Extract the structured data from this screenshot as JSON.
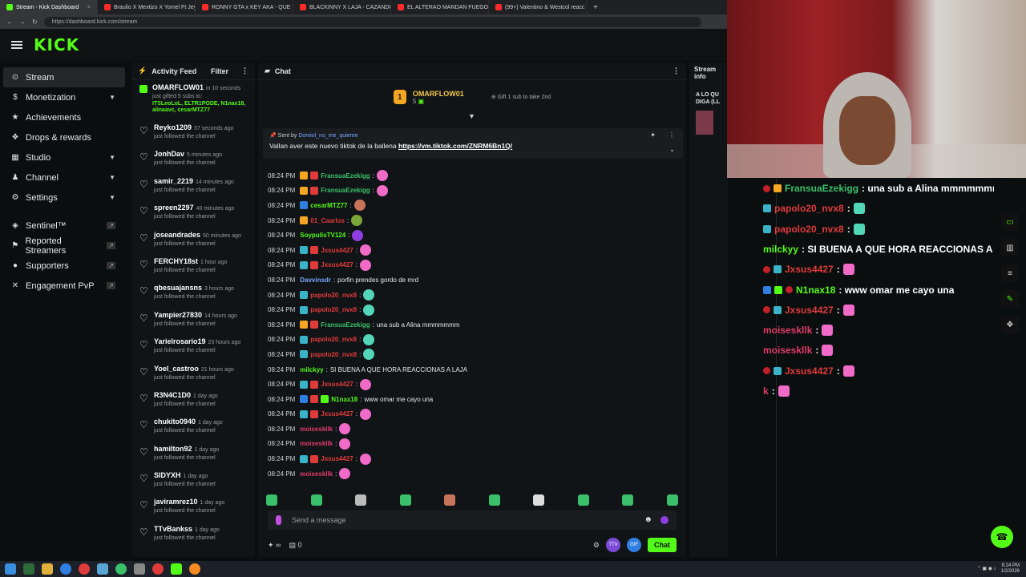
{
  "browser": {
    "tabs": [
      {
        "title": "Stream - Kick Dashboard",
        "color": "#53fc18",
        "active": true
      },
      {
        "title": "Braulio X Mextizo X Yomel Ft Jey",
        "color": "#ff2a2a"
      },
      {
        "title": "RONNY GTA x KEY AKA - QUE TE",
        "color": "#ff2a2a"
      },
      {
        "title": "BLACKINNY X LAJA - CAZANDO",
        "color": "#ff2a2a"
      },
      {
        "title": "EL ALTERAO MANDAN FUEGO",
        "color": "#ff2a2a"
      },
      {
        "title": "(99+) Valentino & Westcol reacc",
        "color": "#ff2a2a"
      }
    ],
    "url": "https://dashboard.kick.com/stream"
  },
  "header": {
    "logo": "KICK"
  },
  "sidebar": {
    "items": [
      {
        "label": "Stream",
        "icon": "stream-icon",
        "glyph": "⊙",
        "active": true
      },
      {
        "label": "Monetization",
        "icon": "dollar-icon",
        "glyph": "$",
        "chevron": true
      },
      {
        "label": "Achievements",
        "icon": "trophy-icon",
        "glyph": "★"
      },
      {
        "label": "Drops & rewards",
        "icon": "gift-icon",
        "glyph": "❖"
      },
      {
        "label": "Studio",
        "icon": "studio-icon",
        "glyph": "▦",
        "chevron": true
      },
      {
        "label": "Channel",
        "icon": "channel-icon",
        "glyph": "♟",
        "chevron": true
      },
      {
        "label": "Settings",
        "icon": "gear-icon",
        "glyph": "⚙",
        "chevron": true
      }
    ],
    "tools": [
      {
        "label": "Sentinel™",
        "icon": "shield-icon",
        "glyph": "◈"
      },
      {
        "label": "Reported Streamers",
        "icon": "flag-icon",
        "glyph": "⚑"
      },
      {
        "label": "Supporters",
        "icon": "users-icon",
        "glyph": "●"
      },
      {
        "label": "Engagement PvP",
        "icon": "swords-icon",
        "glyph": "✕"
      }
    ]
  },
  "activity": {
    "title": "Activity Feed",
    "filter_label": "Filter",
    "gift": {
      "name": "OMARFLOW01",
      "time": "in 10 seconds",
      "text": "just gifted 5 subs to:",
      "recipients": "ITSLeoLoL, ELTR1PODE, N1nax18, alinaavc, cesarMTZ77"
    },
    "follows": [
      {
        "name": "Reyko1209",
        "time": "37 seconds ago"
      },
      {
        "name": "JonhDav",
        "time": "5 minutes ago"
      },
      {
        "name": "samir_2219",
        "time": "14 minutes ago"
      },
      {
        "name": "spreen2297",
        "time": "40 minutes ago"
      },
      {
        "name": "joseandrades",
        "time": "50 minutes ago"
      },
      {
        "name": "FERCHY18st",
        "time": "1 hour ago"
      },
      {
        "name": "qbesuajansns",
        "time": "3 hours ago"
      },
      {
        "name": "Yampier27830",
        "time": "14 hours ago"
      },
      {
        "name": "Yarielrosario19",
        "time": "20 hours ago"
      },
      {
        "name": "Yoel_castroo",
        "time": "21 hours ago"
      },
      {
        "name": "R3N4C1D0",
        "time": "1 day ago"
      },
      {
        "name": "chukito0940",
        "time": "1 day ago"
      },
      {
        "name": "hamilton92",
        "time": "1 day ago"
      },
      {
        "name": "SIDYXH",
        "time": "1 day ago"
      },
      {
        "name": "javiramrez10",
        "time": "1 day ago"
      },
      {
        "name": "TTvBankss",
        "time": "1 day ago"
      }
    ],
    "follow_text": "just followed the channel"
  },
  "chat": {
    "title": "Chat",
    "top_gifter": {
      "rank": "1",
      "name": "OMARFLOW01",
      "count": "5",
      "hint": "Gift 1 sub to take 2nd"
    },
    "pinned": {
      "sent_by_prefix": "Sent by",
      "sender": "Domiol_no_me_quieree",
      "text": "Vallan aver este nuevo tiktok de la ballena",
      "link": "https://vm.tiktok.com/ZNRM6Bn1Q/"
    },
    "messages": [
      {
        "time": "08:24 PM",
        "user": "FransuaEzekigg",
        "color": "#3ac06a",
        "badges": [
          "#f5a623",
          "#e03b3b"
        ],
        "text": "",
        "emote": "#f06ac8"
      },
      {
        "time": "08:24 PM",
        "user": "FransuaEzekigg",
        "color": "#3ac06a",
        "badges": [
          "#f5a623",
          "#e03b3b"
        ],
        "text": "",
        "emote": "#f06ac8"
      },
      {
        "time": "08:24 PM",
        "user": "cesarMTZ77",
        "color": "#53fc18",
        "badges": [
          "#2f7fe0"
        ],
        "text": "",
        "emote": "#c8745a"
      },
      {
        "time": "08:24 PM",
        "user": "01_Caarlos",
        "color": "#e03b3b",
        "badges": [
          "#f5a623"
        ],
        "text": "",
        "emote": "#7aa63a"
      },
      {
        "time": "08:24 PM",
        "user": "SoypulisTV124",
        "color": "#53fc18",
        "badges": [],
        "text": "",
        "emote": "#8d3ee0"
      },
      {
        "time": "08:24 PM",
        "user": "Jxsus4427",
        "color": "#e03b3b",
        "badges": [
          "#3ab3c8",
          "#e03b3b"
        ],
        "text": "",
        "emote": "#f06ac8"
      },
      {
        "time": "08:24 PM",
        "user": "Jxsus4427",
        "color": "#e03b3b",
        "badges": [
          "#3ab3c8",
          "#e03b3b"
        ],
        "text": "",
        "emote": "#f06ac8"
      },
      {
        "time": "08:24 PM",
        "user": "Davvinsdr",
        "color": "#7aa6ff",
        "badges": [],
        "text": "porfin prendes gordo de mrd",
        "emote": ""
      },
      {
        "time": "08:24 PM",
        "user": "papolo20_nvx8",
        "color": "#e03b3b",
        "badges": [
          "#3ab3c8"
        ],
        "text": "",
        "emote": "#53d6b8"
      },
      {
        "time": "08:24 PM",
        "user": "papolo20_nvx8",
        "color": "#e03b3b",
        "badges": [
          "#3ab3c8"
        ],
        "text": "",
        "emote": "#53d6b8"
      },
      {
        "time": "08:24 PM",
        "user": "FransuaEzekigg",
        "color": "#3ac06a",
        "badges": [
          "#f5a623",
          "#e03b3b"
        ],
        "text": "una sub a Alina mmmmmmm",
        "emote": ""
      },
      {
        "time": "08:24 PM",
        "user": "papolo20_nvx8",
        "color": "#e03b3b",
        "badges": [
          "#3ab3c8"
        ],
        "text": "",
        "emote": "#53d6b8"
      },
      {
        "time": "08:24 PM",
        "user": "papolo20_nvx8",
        "color": "#e03b3b",
        "badges": [
          "#3ab3c8"
        ],
        "text": "",
        "emote": "#53d6b8"
      },
      {
        "time": "08:24 PM",
        "user": "milckyy",
        "color": "#53fc18",
        "badges": [],
        "text": "SI BUENA A QUE HORA REACCIONAS A LAJA",
        "emote": ""
      },
      {
        "time": "08:24 PM",
        "user": "Jxsus4427",
        "color": "#e03b3b",
        "badges": [
          "#3ab3c8",
          "#e03b3b"
        ],
        "text": "",
        "emote": "#f06ac8"
      },
      {
        "time": "08:24 PM",
        "user": "N1nax18",
        "color": "#53fc18",
        "badges": [
          "#2f7fe0",
          "#e03b3b",
          "#53fc18"
        ],
        "text": "www omar me cayo una",
        "emote": ""
      },
      {
        "time": "08:24 PM",
        "user": "Jxsus4427",
        "color": "#e03b3b",
        "badges": [
          "#3ab3c8",
          "#e03b3b"
        ],
        "text": "",
        "emote": "#f06ac8"
      },
      {
        "time": "08:24 PM",
        "user": "moiseskllk",
        "color": "#e03b6a",
        "badges": [],
        "text": "",
        "emote": "#f06ac8"
      },
      {
        "time": "08:24 PM",
        "user": "moiseskllk",
        "color": "#e03b6a",
        "badges": [],
        "text": "",
        "emote": "#f06ac8"
      },
      {
        "time": "08:24 PM",
        "user": "Jxsus4427",
        "color": "#e03b3b",
        "badges": [
          "#3ab3c8",
          "#e03b3b"
        ],
        "text": "",
        "emote": "#f06ac8"
      },
      {
        "time": "08:24 PM",
        "user": "moiseskllk",
        "color": "#e03b6a",
        "badges": [],
        "text": "",
        "emote": "#f06ac8"
      }
    ],
    "input_placeholder": "Send a message",
    "footer_count": "0",
    "send_label": "Chat"
  },
  "stream_info": {
    "title": "Stream info",
    "snippet": "A LO QU DIGA (LL"
  },
  "overlay": {
    "messages": [
      {
        "user": "FransuaEzekigg",
        "color": "#3ac06a",
        "text": ": una sub a Alina mmmmmmm",
        "badges": [
          "dot",
          "#f5a623"
        ],
        "emote": ""
      },
      {
        "user": "papolo20_nvx8",
        "color": "#e03b3b",
        "text": ":",
        "badges": [
          "#3ab3c8"
        ],
        "emote": "#53d6b8"
      },
      {
        "user": "papolo20_nvx8",
        "color": "#e03b3b",
        "text": ":",
        "badges": [
          "#3ab3c8"
        ],
        "emote": "#53d6b8"
      },
      {
        "user": "milckyy",
        "color": "#53fc18",
        "text": ": SI BUENA A QUE HORA REACCIONAS A LAJA",
        "badges": [],
        "emote": ""
      },
      {
        "user": "Jxsus4427",
        "color": "#e03b3b",
        "text": ":",
        "badges": [
          "dot",
          "#3ab3c8"
        ],
        "emote": "#f06ac8"
      },
      {
        "user": "N1nax18",
        "color": "#53fc18",
        "text": ": www omar me cayo una",
        "badges": [
          "#2f7fe0",
          "#53fc18",
          "dot"
        ],
        "emote": ""
      },
      {
        "user": "Jxsus4427",
        "color": "#e03b3b",
        "text": ":",
        "badges": [
          "dot",
          "#3ab3c8"
        ],
        "emote": "#f06ac8"
      },
      {
        "user": "moiseskllk",
        "color": "#e03b6a",
        "text": ":",
        "badges": [],
        "emote": "#f06ac8"
      },
      {
        "user": "moiseskllk",
        "color": "#e03b6a",
        "text": ":",
        "badges": [],
        "emote": "#f06ac8"
      },
      {
        "user": "Jxsus4427",
        "color": "#e03b3b",
        "text": ":",
        "badges": [
          "dot",
          "#3ab3c8"
        ],
        "emote": "#f06ac8"
      },
      {
        "user": "k",
        "color": "#e03b6a",
        "text": ":",
        "badges": [],
        "emote": "#f06ac8"
      }
    ]
  },
  "taskbar": {
    "time": "8:24 PM",
    "date": "1/2/2026"
  },
  "colors": {
    "accent": "#53fc18",
    "background": "#0b0e0f",
    "panel": "#111416"
  }
}
